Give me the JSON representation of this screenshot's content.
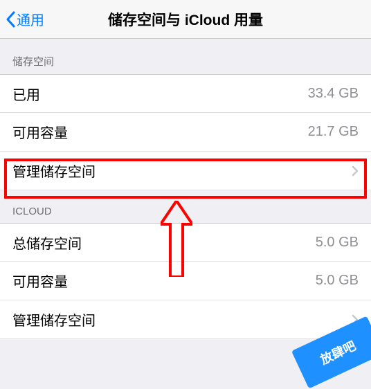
{
  "header": {
    "back_label": "通用",
    "title": "储存空间与 iCloud 用量"
  },
  "sections": {
    "storage": {
      "header": "储存空间",
      "used_label": "已用",
      "used_value": "33.4 GB",
      "available_label": "可用容量",
      "available_value": "21.7 GB",
      "manage_label": "管理储存空间"
    },
    "icloud": {
      "header": "ICLOUD",
      "total_label": "总储存空间",
      "total_value": "5.0 GB",
      "available_label": "可用容量",
      "available_value": "5.0 GB",
      "manage_label": "管理储存空间"
    }
  },
  "annotation": {
    "highlight_color": "#ff0000",
    "arrow_color": "#ff0000"
  },
  "watermark": "放肆吧"
}
